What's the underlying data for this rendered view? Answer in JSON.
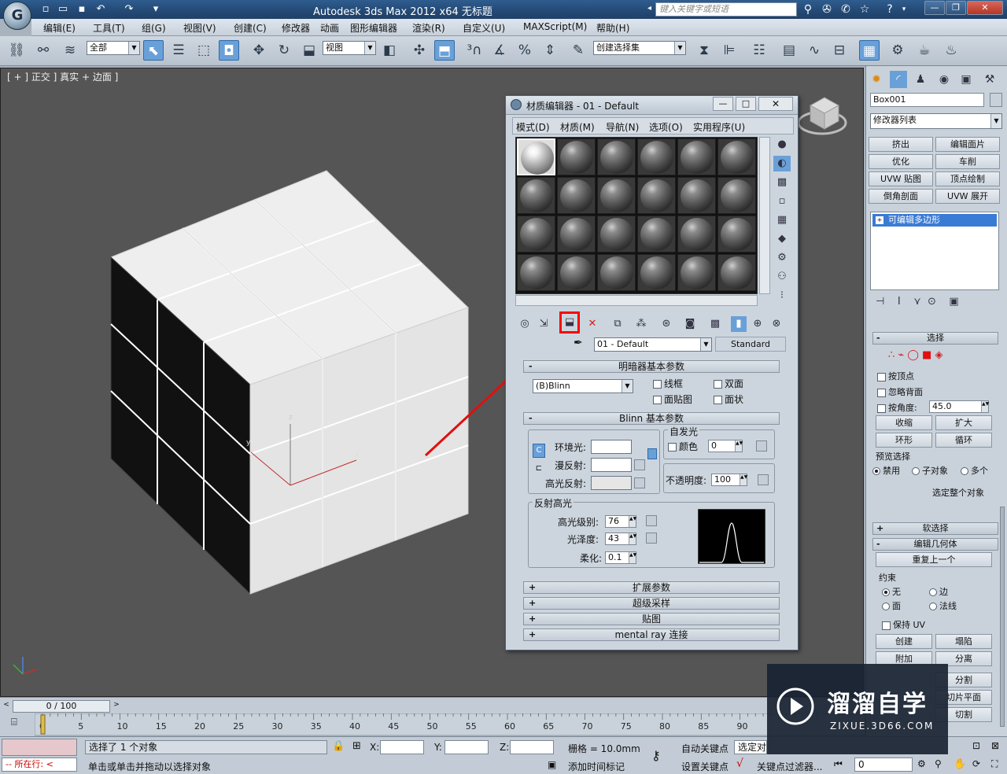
{
  "window": {
    "title": "Autodesk 3ds Max  2012 x64      无标题",
    "search_placeholder": "键入关键字或短语",
    "controls": [
      "—",
      "❐",
      "✕"
    ]
  },
  "menubar": [
    "编辑(E)",
    "工具(T)",
    "组(G)",
    "视图(V)",
    "创建(C)",
    "修改器",
    "动画",
    "图形编辑器",
    "渲染(R)",
    "自定义(U)",
    "MAXScript(M)",
    "帮助(H)"
  ],
  "toolbar": {
    "selection_filter": "全部",
    "ref_coord": "视图",
    "named_selection": "创建选择集"
  },
  "viewport": {
    "label": "[ + ] 正交 ] 真实 + 边面 ]",
    "axis_x": "x",
    "axis_y": "y",
    "axis_z": "z",
    "background": "#555555"
  },
  "material_editor": {
    "title": "材质编辑器 - 01 - Default",
    "menu": [
      "模式(D)",
      "材质(M)",
      "导航(N)",
      "选项(O)",
      "实用程序(U)"
    ],
    "material_name": "01 - Default",
    "material_type": "Standard",
    "rollouts": {
      "shader_basic": "明暗器基本参数",
      "blinn_basic": "Blinn 基本参数",
      "extended": "扩展参数",
      "supersampling": "超级采样",
      "maps": "贴图",
      "mental_ray": "mental ray 连接"
    },
    "shader": {
      "type": "(B)Blinn",
      "wire": "线框",
      "two_sided": "双面",
      "face_map": "面贴图",
      "faceted": "面状"
    },
    "blinn": {
      "ambient": "环境光:",
      "diffuse": "漫反射:",
      "specular": "高光反射:",
      "self_illum_group": "自发光",
      "color": "颜色",
      "self_illum_value": "0",
      "opacity_label": "不透明度:",
      "opacity_value": "100",
      "spec_group": "反射高光",
      "spec_level_label": "高光级别:",
      "spec_level": "76",
      "glossiness_label": "光泽度:",
      "glossiness": "43",
      "soften_label": "柔化:",
      "soften": "0.1"
    },
    "highlight_color": "#ff0000"
  },
  "command_panel": {
    "object_name": "Box001",
    "modifier_list": "修改器列表",
    "modifier_buttons": [
      "挤出",
      "编辑面片",
      "优化",
      "车削",
      "UVW 贴图",
      "顶点绘制",
      "倒角剖面",
      "UVW 展开"
    ],
    "stack_item": "可编辑多边形",
    "selection_rollout": "选择",
    "by_vertex": "按顶点",
    "ignore_backfacing": "忽略背面",
    "by_angle": "按角度:",
    "angle_value": "45.0",
    "shrink": "收缩",
    "grow": "扩大",
    "ring": "环形",
    "loop": "循环",
    "preview_selection": "预览选择",
    "preview_options": [
      "禁用",
      "子对象",
      "多个"
    ],
    "select_whole": "选定整个对象",
    "soft_selection": "软选择",
    "edit_geometry": "编辑几何体",
    "repeat_last": "重复上一个",
    "constraints": "约束",
    "constraint_options": [
      "无",
      "边",
      "面",
      "法线"
    ],
    "preserve_uv": "保持 UV",
    "create": "创建",
    "collapse": "塌陷",
    "attach": "附加",
    "detach": "分离",
    "slice_plane": "切片平面",
    "split": "分割",
    "cut": "切割"
  },
  "timeline": {
    "frame_display": "0 / 100",
    "ticks": [
      "0",
      "5",
      "10",
      "15",
      "20",
      "25",
      "30",
      "35",
      "40",
      "45",
      "50",
      "55",
      "60",
      "65",
      "70",
      "75",
      "80",
      "85",
      "90"
    ]
  },
  "status": {
    "selected": "选择了 1 个对象",
    "prompt": "单击或单击并拖动以选择对象",
    "running": "所在行:",
    "x_label": "X:",
    "y_label": "Y:",
    "z_label": "Z:",
    "grid": "栅格 = 10.0mm",
    "auto_key": "自动关键点",
    "selected_set": "选定对",
    "set_key": "设置关键点",
    "key_filters": "关键点过滤器...",
    "add_time_tag": "添加时间标记",
    "frame_value": "0"
  },
  "watermark": {
    "brand": "溜溜自学",
    "url": "ZIXUE.3D66.COM"
  }
}
